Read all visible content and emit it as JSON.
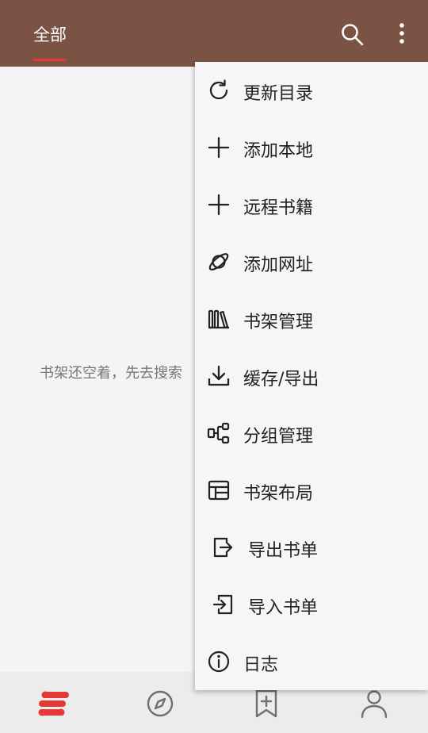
{
  "header": {
    "tab_label": "全部",
    "icons": [
      "search-icon",
      "more-vert-icon"
    ]
  },
  "main": {
    "empty_message": "书架还空着，先去搜索"
  },
  "menu": {
    "items": [
      {
        "label": "更新目录",
        "icon": "refresh-icon"
      },
      {
        "label": "添加本地",
        "icon": "plus-icon"
      },
      {
        "label": "远程书籍",
        "icon": "plus-icon"
      },
      {
        "label": "添加网址",
        "icon": "planet-icon"
      },
      {
        "label": "书架管理",
        "icon": "bookshelf-icon"
      },
      {
        "label": "缓存/导出",
        "icon": "download-icon"
      },
      {
        "label": "分组管理",
        "icon": "group-icon"
      },
      {
        "label": "书架布局",
        "icon": "layout-icon"
      },
      {
        "label": "导出书单",
        "icon": "export-icon"
      },
      {
        "label": "导入书单",
        "icon": "import-icon"
      },
      {
        "label": "日志",
        "icon": "info-icon"
      }
    ]
  },
  "bottom_nav": {
    "items": [
      {
        "icon": "bookshelf-logo-icon",
        "active": true
      },
      {
        "icon": "compass-icon",
        "active": false
      },
      {
        "icon": "bookmark-add-icon",
        "active": false
      },
      {
        "icon": "user-icon",
        "active": false
      }
    ]
  },
  "colors": {
    "header_bg": "#7b5344",
    "accent": "#e53935",
    "page_bg": "#f4f4f4",
    "menu_bg": "#f6f6f6"
  }
}
